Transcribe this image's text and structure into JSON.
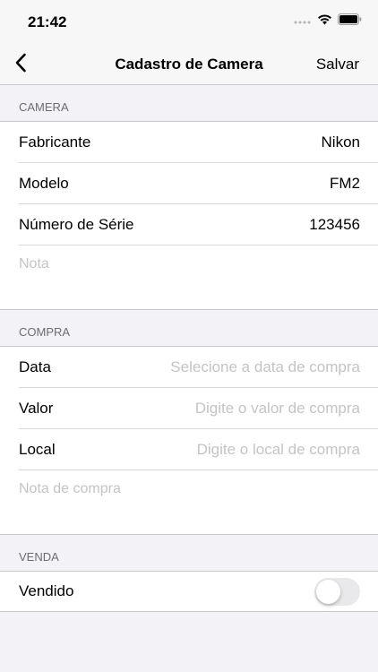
{
  "status": {
    "time": "21:42"
  },
  "nav": {
    "title": "Cadastro de Camera",
    "save_label": "Salvar"
  },
  "camera": {
    "header": "CAMERA",
    "rows": [
      {
        "label": "Fabricante",
        "value": "Nikon"
      },
      {
        "label": "Modelo",
        "value": "FM2"
      },
      {
        "label": "Número de Série",
        "value": "123456"
      }
    ],
    "note_placeholder": "Nota"
  },
  "purchase": {
    "header": "COMPRA",
    "rows": [
      {
        "label": "Data",
        "placeholder": "Selecione a data de compra"
      },
      {
        "label": "Valor",
        "placeholder": "Digite o valor de compra"
      },
      {
        "label": "Local",
        "placeholder": "Digite o local de compra"
      }
    ],
    "note_placeholder": "Nota de compra"
  },
  "sale": {
    "header": "VENDA",
    "sold_label": "Vendido",
    "sold": false
  },
  "colors": {
    "accent": "#007aff",
    "background": "#f2f2f7",
    "placeholder": "#c4c4c7"
  }
}
